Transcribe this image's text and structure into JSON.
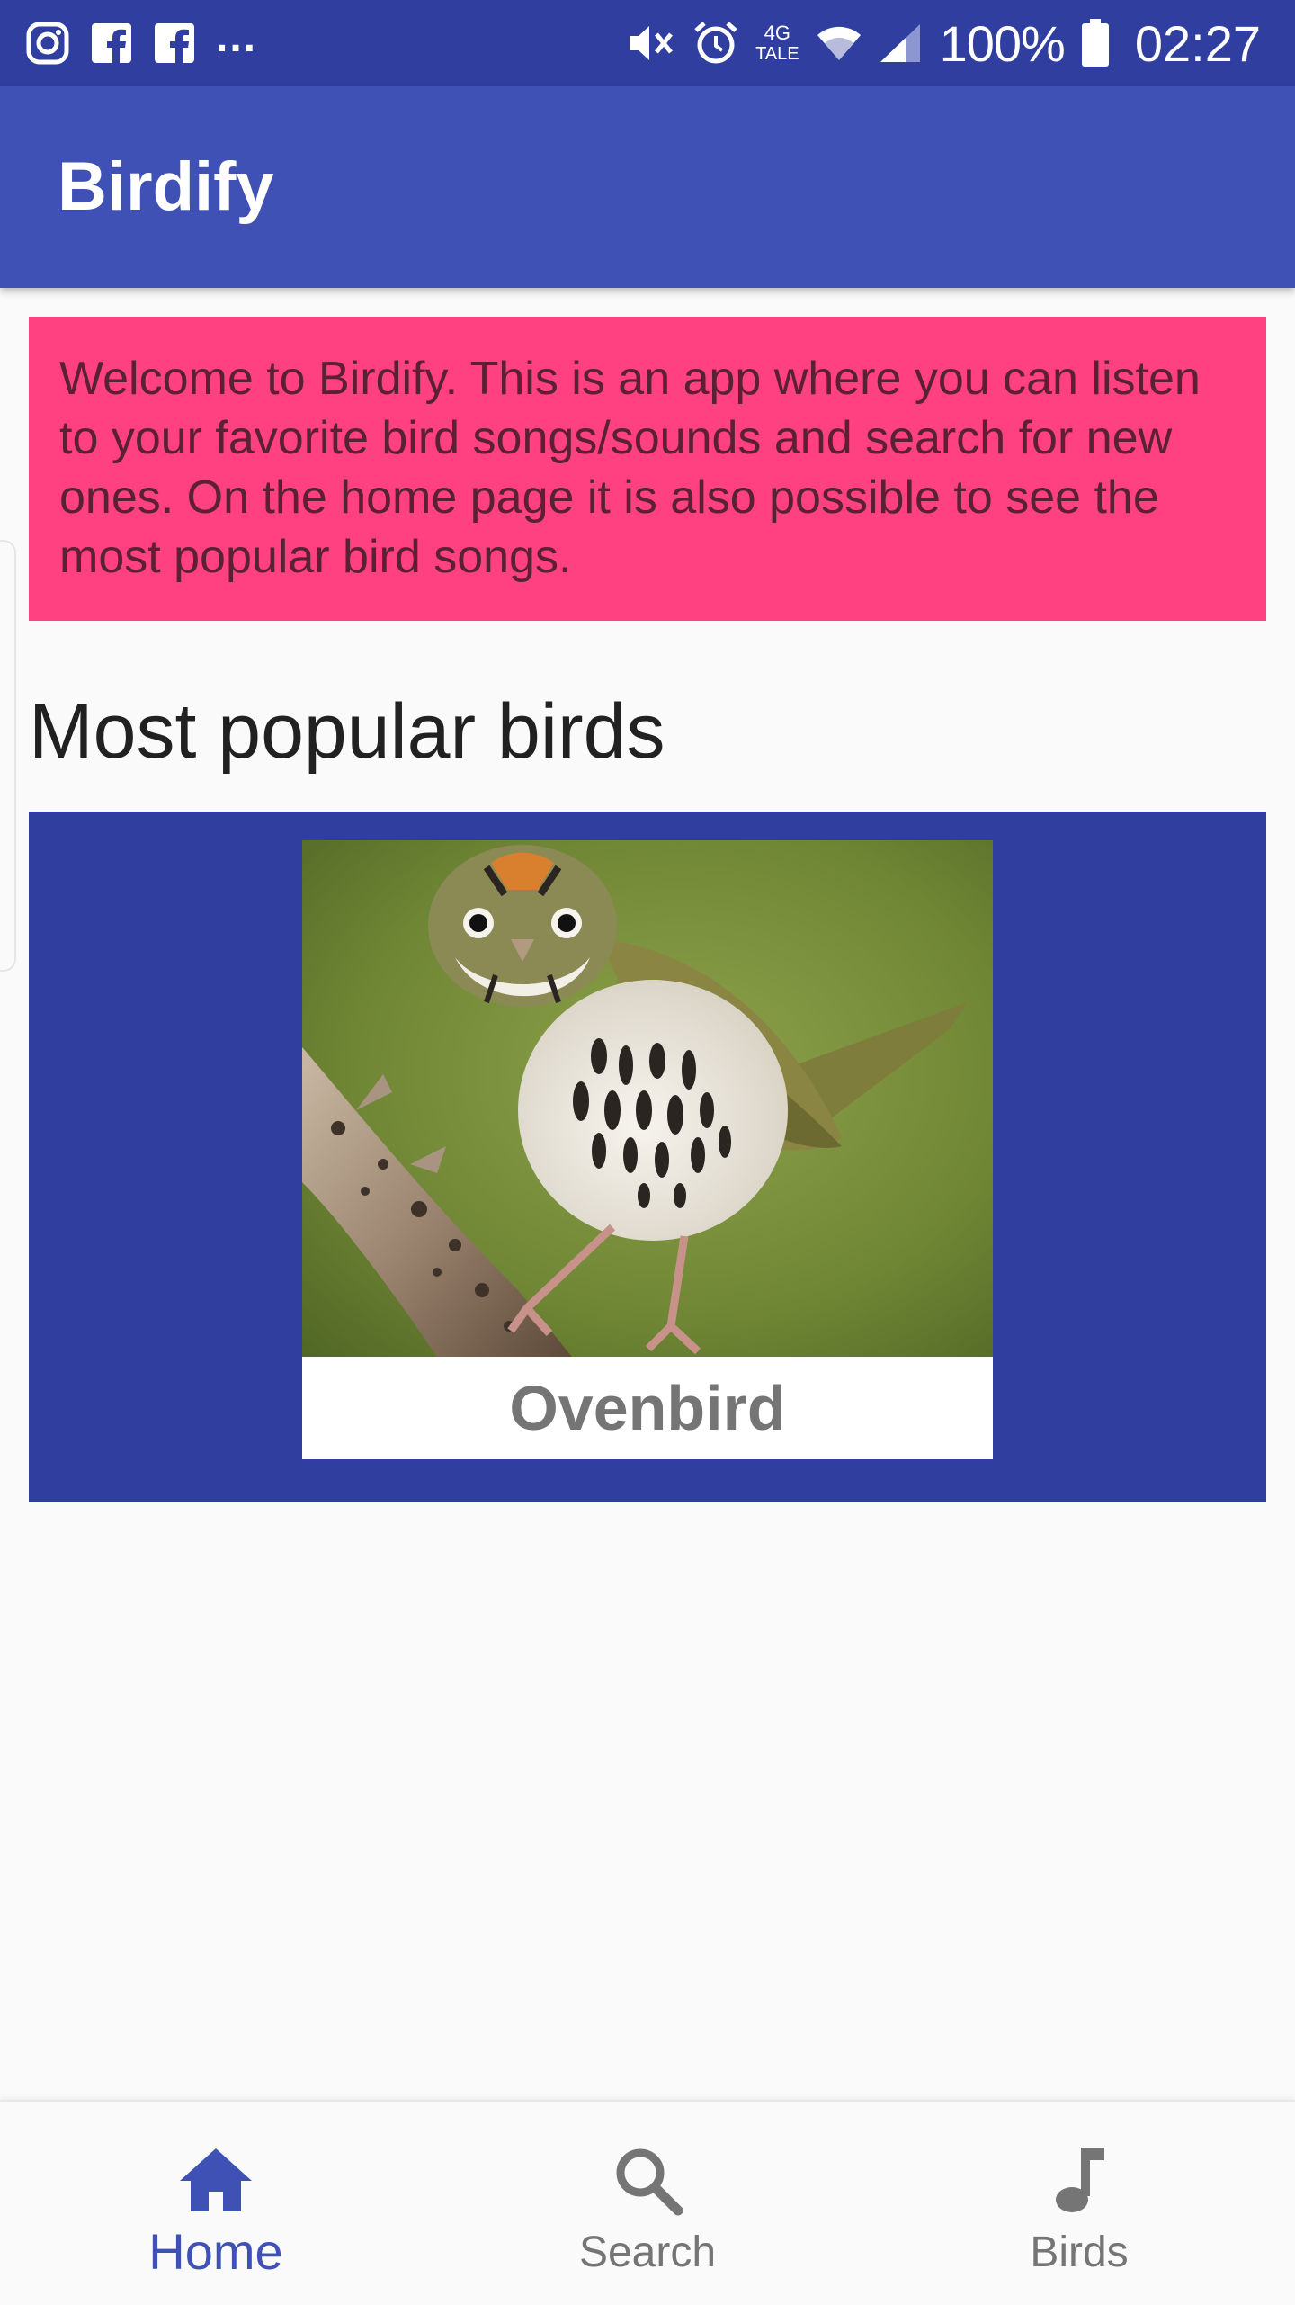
{
  "status_bar": {
    "network_type": "4G",
    "network_sub": "TALE",
    "battery": "100%",
    "time": "02:27",
    "overflow_indicator": "...",
    "left_icons": [
      "instagram-icon",
      "facebook-icon",
      "facebook-icon"
    ],
    "right_icons": [
      "mute-icon",
      "alarm-icon",
      "wifi-icon",
      "signal-icon",
      "battery-icon"
    ]
  },
  "app_bar": {
    "title": "Birdify"
  },
  "welcome": {
    "text": "Welcome to Birdify. This is an app where you can listen to your favorite bird songs/sounds and search for new ones. On the home page it is also possible to see the most popular bird songs."
  },
  "popular": {
    "heading": "Most popular birds",
    "birds": [
      {
        "name": "Ovenbird",
        "image": "ovenbird-photo"
      }
    ]
  },
  "bottom_nav": {
    "items": [
      {
        "label": "Home",
        "icon": "home-icon",
        "active": true
      },
      {
        "label": "Search",
        "icon": "search-icon",
        "active": false
      },
      {
        "label": "Birds",
        "icon": "music-note-icon",
        "active": false
      }
    ]
  },
  "colors": {
    "primary": "#3f51b5",
    "primary_dark": "#303f9f",
    "accent": "#ff4081",
    "background": "#fafafa"
  }
}
